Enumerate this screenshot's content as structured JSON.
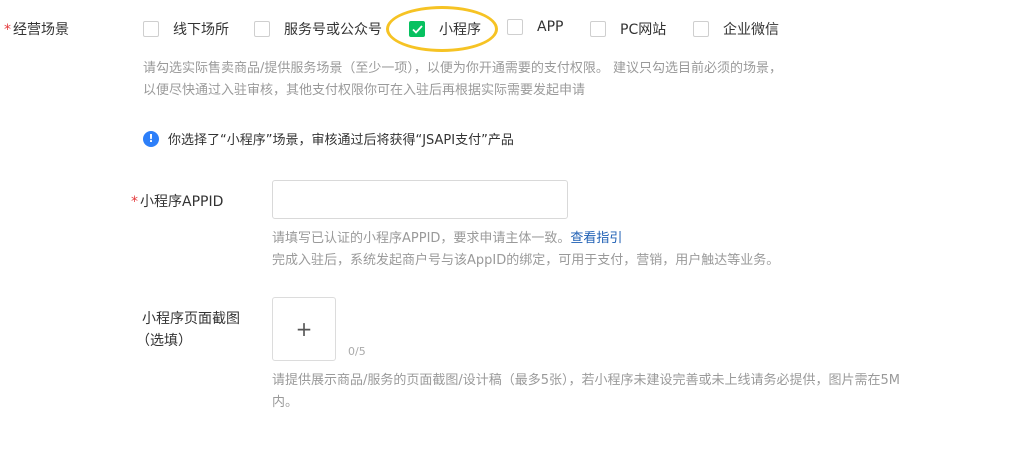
{
  "business_scene": {
    "required_mark": "*",
    "label": "经营场景",
    "options": [
      {
        "label": "线下场所",
        "checked": false
      },
      {
        "label": "服务号或公众号",
        "checked": false
      },
      {
        "label": "小程序",
        "checked": true
      },
      {
        "label": "APP",
        "checked": false
      },
      {
        "label": "PC网站",
        "checked": false
      },
      {
        "label": "企业微信",
        "checked": false
      }
    ],
    "hint_line1": "请勾选实际售卖商品/提供服务场景（至少一项），以便为你开通需要的支付权限。 建议只勾选目前必须的场景，",
    "hint_line2": "以便尽快通过入驻审核，其他支付权限你可在入驻后再根据实际需要发起申请"
  },
  "notice": {
    "icon": "info-icon",
    "text": "你选择了“小程序”场景，审核通过后将获得“JSAPI支付”产品"
  },
  "appid": {
    "required_mark": "*",
    "label": "小程序APPID",
    "value": "",
    "placeholder": "",
    "hint_line1_prefix": "请填写已认证的小程序APPID，要求申请主体一致。",
    "hint_link": "查看指引",
    "hint_line2": "完成入驻后，系统发起商户号与该AppID的绑定，可用于支付，营销，用户触达等业务。"
  },
  "screenshot": {
    "label_line1": "小程序页面截图",
    "label_line2": "（选填）",
    "upload_glyph": "+",
    "count": "0/5",
    "hint_line1": "请提供展示商品/服务的页面截图/设计稿（最多5张），若小程序未建设完善或未上线请务必提供，图片需在5M",
    "hint_line2": "内。"
  },
  "colors": {
    "accent_green": "#07c160",
    "highlight_yellow": "#f6c324",
    "info_blue": "#2d7ff9",
    "link_blue": "#1e5fb4",
    "required_red": "#e4393c"
  }
}
